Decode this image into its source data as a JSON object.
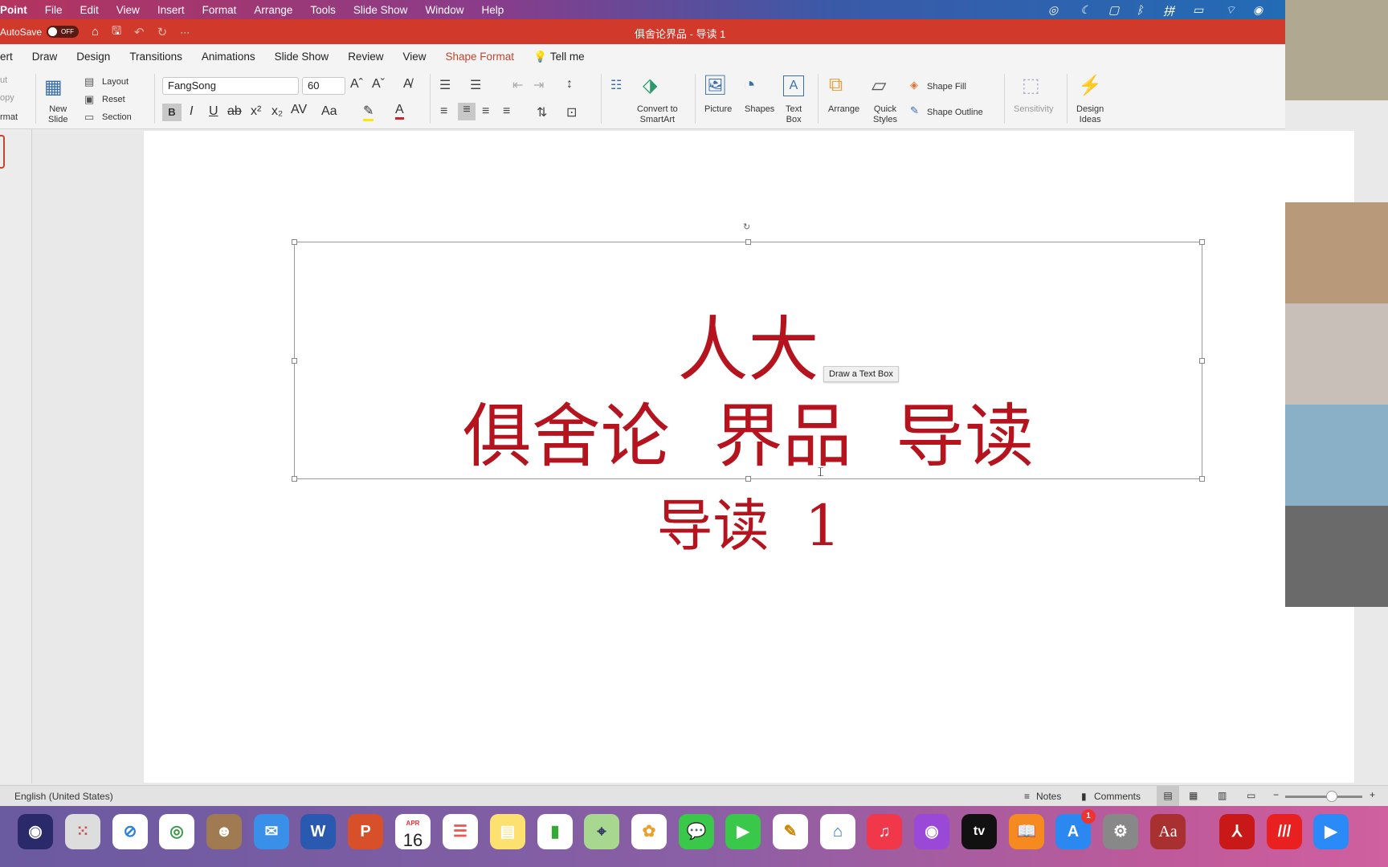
{
  "menubar": {
    "app": "Point",
    "items": [
      "File",
      "Edit",
      "View",
      "Insert",
      "Format",
      "Arrange",
      "Tools",
      "Slide Show",
      "Window",
      "Help"
    ]
  },
  "titlebar": {
    "autosave": "AutoSave",
    "toggle": "OFF",
    "title": "俱舍论界品 - 导读 1"
  },
  "tabs": [
    {
      "label": "ert"
    },
    {
      "label": "Draw"
    },
    {
      "label": "Design"
    },
    {
      "label": "Transitions"
    },
    {
      "label": "Animations"
    },
    {
      "label": "Slide Show"
    },
    {
      "label": "Review"
    },
    {
      "label": "View"
    },
    {
      "label": "Shape Format",
      "active": true
    },
    {
      "label": "Tell me"
    }
  ],
  "ribbon": {
    "clipboard": [
      "ut",
      "opy",
      "rmat"
    ],
    "new_slide": "New\nSlide",
    "layout": "Layout",
    "reset": "Reset",
    "section": "Section",
    "font": "FangSong",
    "size": "60",
    "convert": "Convert to\nSmartArt",
    "picture": "Picture",
    "shapes": "Shapes",
    "textbox": "Text\nBox",
    "arrange": "Arrange",
    "quick_styles": "Quick\nStyles",
    "shape_fill": "Shape Fill",
    "shape_outline": "Shape Outline",
    "sensitivity": "Sensitivity",
    "design_ideas": "Design\nIdeas"
  },
  "slide": {
    "line1": "人大",
    "line2": "俱舍论  界品  导读",
    "line3": "导读  1",
    "text_color": "#b5141e"
  },
  "tooltip": "Draw a Text Box",
  "status": {
    "language": "English (United States)",
    "notes": "Notes",
    "comments": "Comments",
    "zoom_level": 0.6
  },
  "dock": {
    "calendar_month": "APR",
    "calendar_day": "16",
    "appstore_badge": "1",
    "apps": [
      "finder",
      "siri",
      "launchpad",
      "safari",
      "chrome",
      "contacts",
      "mail",
      "word",
      "powerpoint",
      "calendar",
      "reminders",
      "notes",
      "numbers",
      "maps",
      "photos",
      "messages",
      "facetime",
      "pages",
      "keynote",
      "music",
      "podcasts",
      "tv",
      "books",
      "app-store",
      "system-preferences",
      "dictionary",
      "acrobat",
      "app",
      "zoom"
    ]
  }
}
